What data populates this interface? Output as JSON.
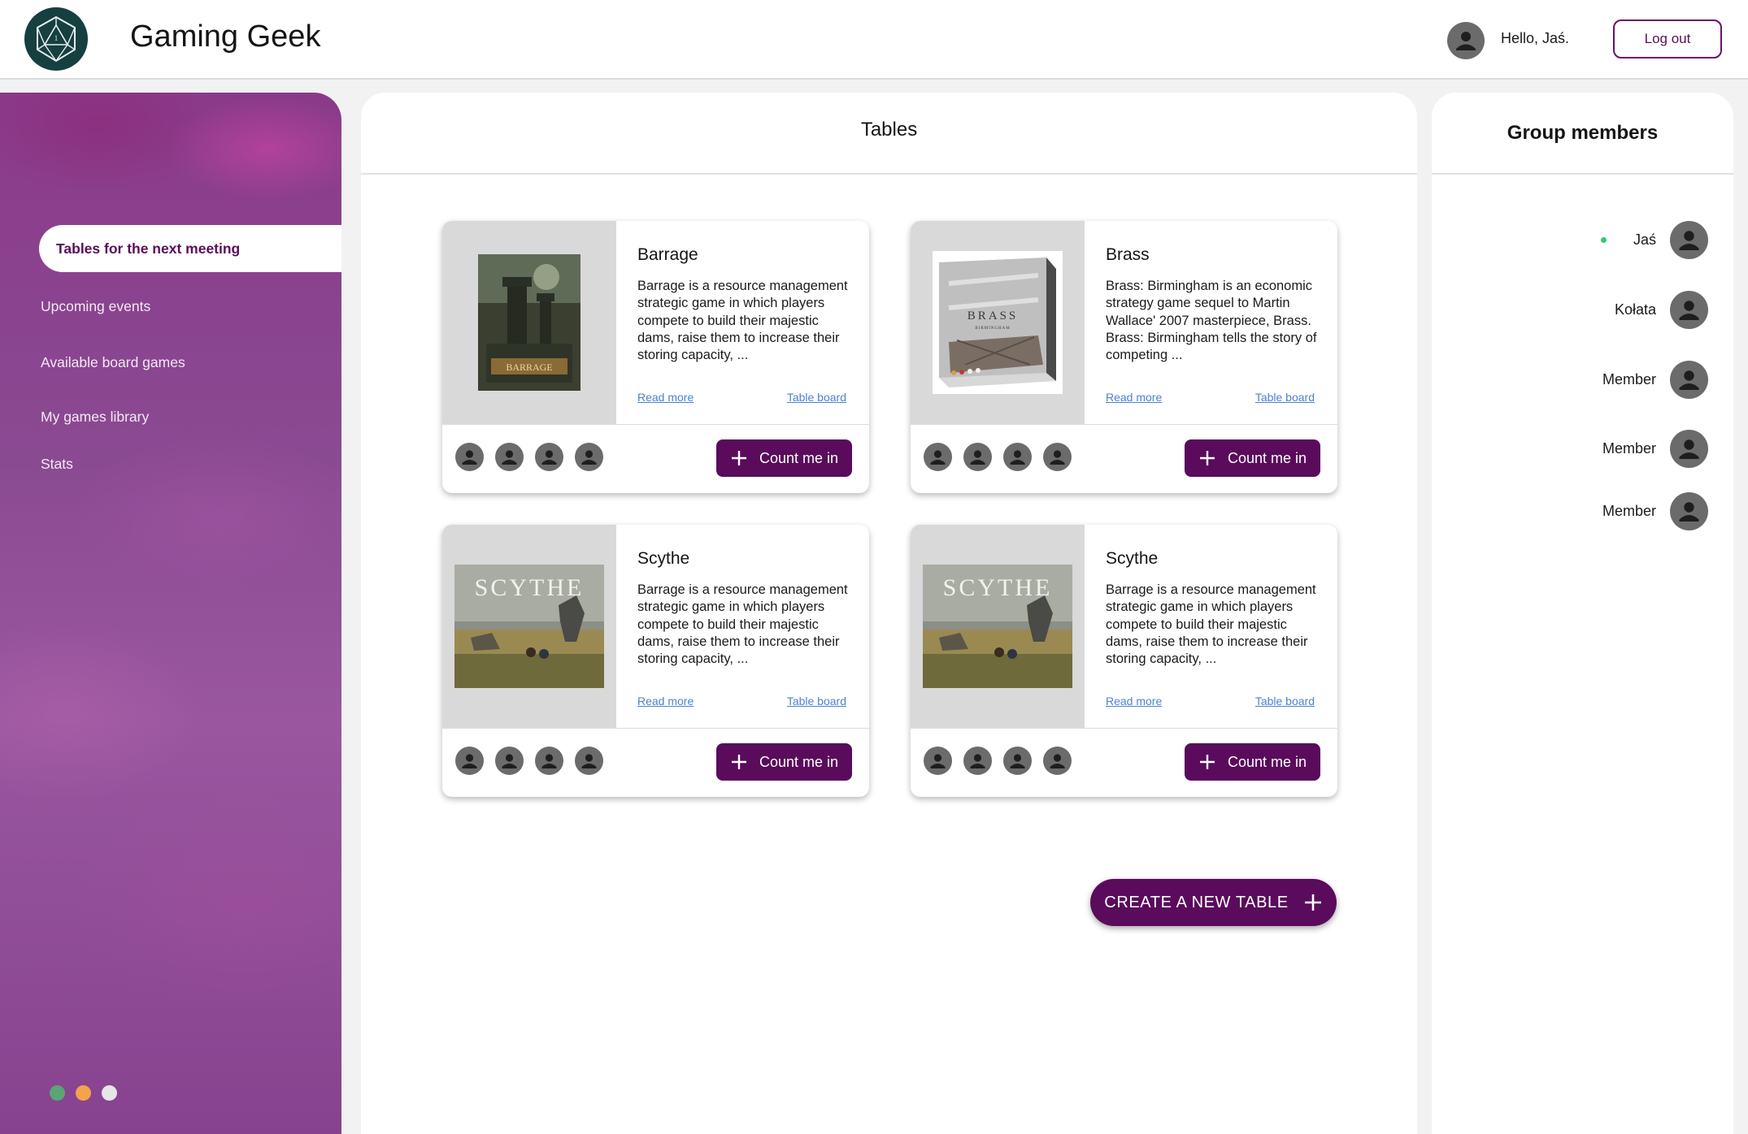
{
  "app": {
    "title": "Gaming Geek",
    "logo_icon": "d20-dice-icon"
  },
  "user": {
    "greeting": "Hello, Jaś.",
    "logout_label": "Log out"
  },
  "sidebar": {
    "items": [
      {
        "label": "Tables for the next meeting",
        "active": true
      },
      {
        "label": "Upcoming events",
        "active": false
      },
      {
        "label": "Available board games",
        "active": false
      },
      {
        "label": "My games library",
        "active": false
      },
      {
        "label": "Stats",
        "active": false
      }
    ],
    "dots": [
      "#5aa573",
      "#f2a44a",
      "#e6e6e6"
    ]
  },
  "main": {
    "title": "Tables",
    "cards": [
      {
        "title": "Barrage",
        "description": "Barrage is a resource management strategic game in which players compete to build their majestic dams, raise them to increase their storing capacity, ...",
        "read_more": "Read more",
        "table_board": "Table board",
        "count_label": "Count me in",
        "cover_text": "BARRAGE"
      },
      {
        "title": "Brass",
        "description": "Brass: Birmingham is an economic strategy game sequel to Martin Wallace' 2007 masterpiece, Brass. Brass: Birmingham tells the story of competing ...",
        "read_more": "Read more",
        "table_board": "Table board",
        "count_label": "Count me in",
        "cover_text": "BRASS",
        "cover_subtext": "BIRMINGHAM"
      },
      {
        "title": "Scythe",
        "description": "Barrage is a resource management strategic game in which players compete to build their majestic dams, raise them to increase their storing capacity, ...",
        "read_more": "Read more",
        "table_board": "Table board",
        "count_label": "Count me in",
        "cover_text": "SCYTHE"
      },
      {
        "title": "Scythe",
        "description": "Barrage is a resource management strategic game in which players compete to build their majestic dams, raise them to increase their storing capacity, ...",
        "read_more": "Read more",
        "table_board": "Table board",
        "count_label": "Count me in",
        "cover_text": "SCYTHE"
      }
    ],
    "create_label": "CREATE A NEW TABLE"
  },
  "members": {
    "title": "Group members",
    "list": [
      {
        "name": "Jaś",
        "online": true
      },
      {
        "name": "Kołata",
        "online": false
      },
      {
        "name": "Member",
        "online": false
      },
      {
        "name": "Member",
        "online": false
      },
      {
        "name": "Member",
        "online": false
      }
    ]
  },
  "colors": {
    "brand": "#5a0b5c",
    "online": "#35c76f",
    "link": "#4c82cf"
  }
}
